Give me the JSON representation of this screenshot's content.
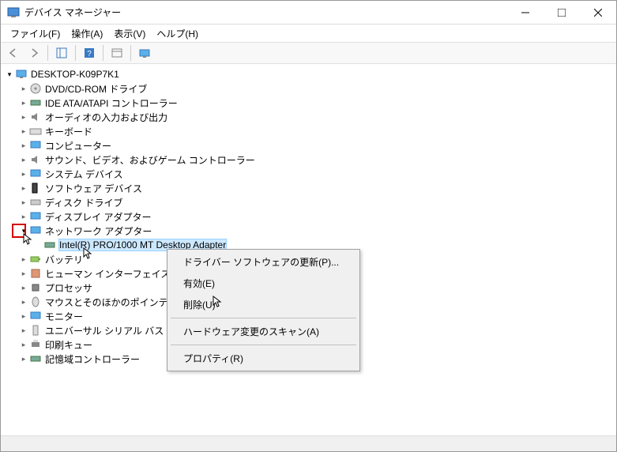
{
  "title": "デバイス マネージャー",
  "menu": {
    "file": "ファイル(F)",
    "action": "操作(A)",
    "view": "表示(V)",
    "help": "ヘルプ(H)"
  },
  "root": "DESKTOP-K09P7K1",
  "nodes": {
    "dvd": "DVD/CD-ROM ドライブ",
    "ide": "IDE ATA/ATAPI コントローラー",
    "audio": "オーディオの入力および出力",
    "keyboard": "キーボード",
    "computer": "コンピューター",
    "sound": "サウンド、ビデオ、およびゲーム コントローラー",
    "system": "システム デバイス",
    "software": "ソフトウェア デバイス",
    "disk": "ディスク ドライブ",
    "display": "ディスプレイ アダプター",
    "network": "ネットワーク アダプター",
    "net_adapter": "Intel(R) PRO/1000 MT Desktop Adapter",
    "battery": "バッテリ",
    "hid": "ヒューマン インターフェイス デ",
    "cpu": "プロセッサ",
    "mouse": "マウスとそのほかのポインティ",
    "monitor": "モニター",
    "usb": "ユニバーサル シリアル バス コ",
    "print": "印刷キュー",
    "storage": "記憶域コントローラー"
  },
  "context": {
    "update": "ドライバー ソフトウェアの更新(P)...",
    "enable": "有効(E)",
    "delete": "削除(U)",
    "scan": "ハードウェア変更のスキャン(A)",
    "props": "プロパティ(R)"
  }
}
